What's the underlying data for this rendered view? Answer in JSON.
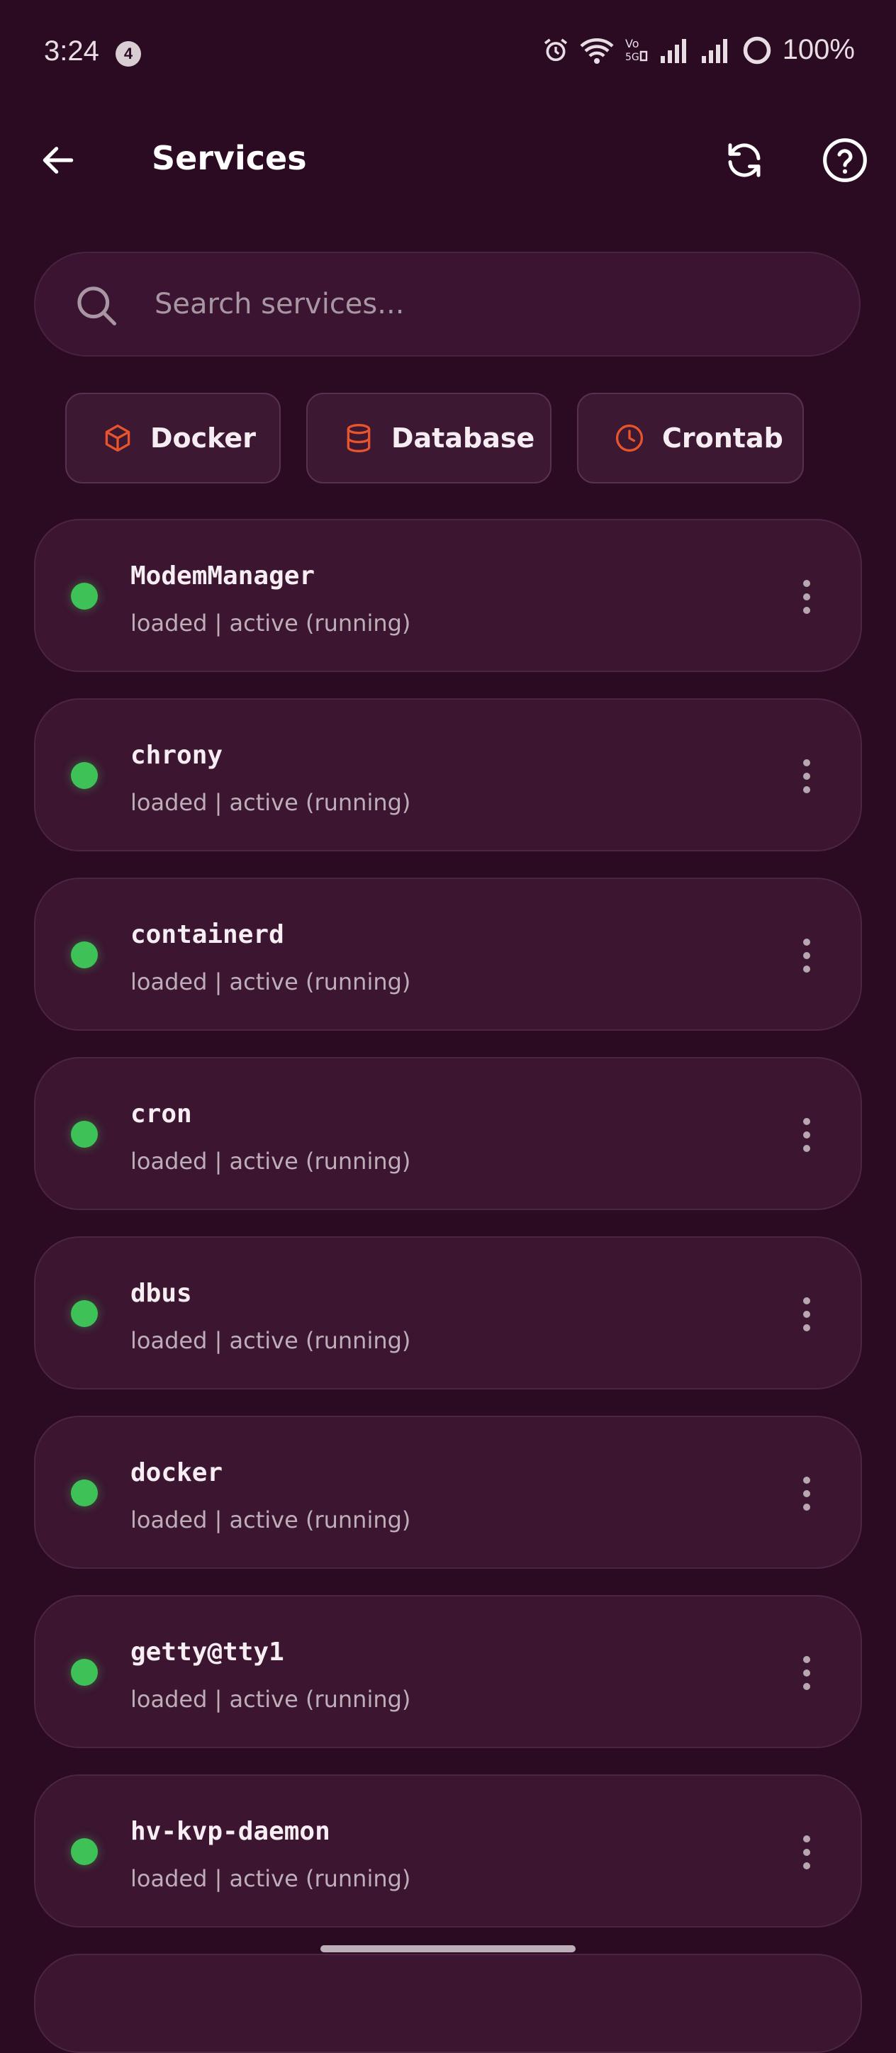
{
  "status_bar": {
    "time": "3:24",
    "notification_count": "4",
    "battery": "100%"
  },
  "app_bar": {
    "title": "Services"
  },
  "search": {
    "placeholder": "Search services..."
  },
  "chips": [
    {
      "label": "Docker",
      "icon": "cube-icon"
    },
    {
      "label": "Database",
      "icon": "database-icon"
    },
    {
      "label": "Crontab",
      "icon": "clock-icon"
    }
  ],
  "services": [
    {
      "name": "ModemManager",
      "status": "loaded | active (running)"
    },
    {
      "name": "chrony",
      "status": "loaded | active (running)"
    },
    {
      "name": "containerd",
      "status": "loaded | active (running)"
    },
    {
      "name": "cron",
      "status": "loaded | active (running)"
    },
    {
      "name": "dbus",
      "status": "loaded | active (running)"
    },
    {
      "name": "docker",
      "status": "loaded | active (running)"
    },
    {
      "name": "getty@tty1",
      "status": "loaded | active (running)"
    },
    {
      "name": "hv-kvp-daemon",
      "status": "loaded | active (running)"
    }
  ],
  "colors": {
    "background": "#2b0b22",
    "card": "#3c1531",
    "accent": "#e8542c",
    "running": "#3ec156"
  }
}
